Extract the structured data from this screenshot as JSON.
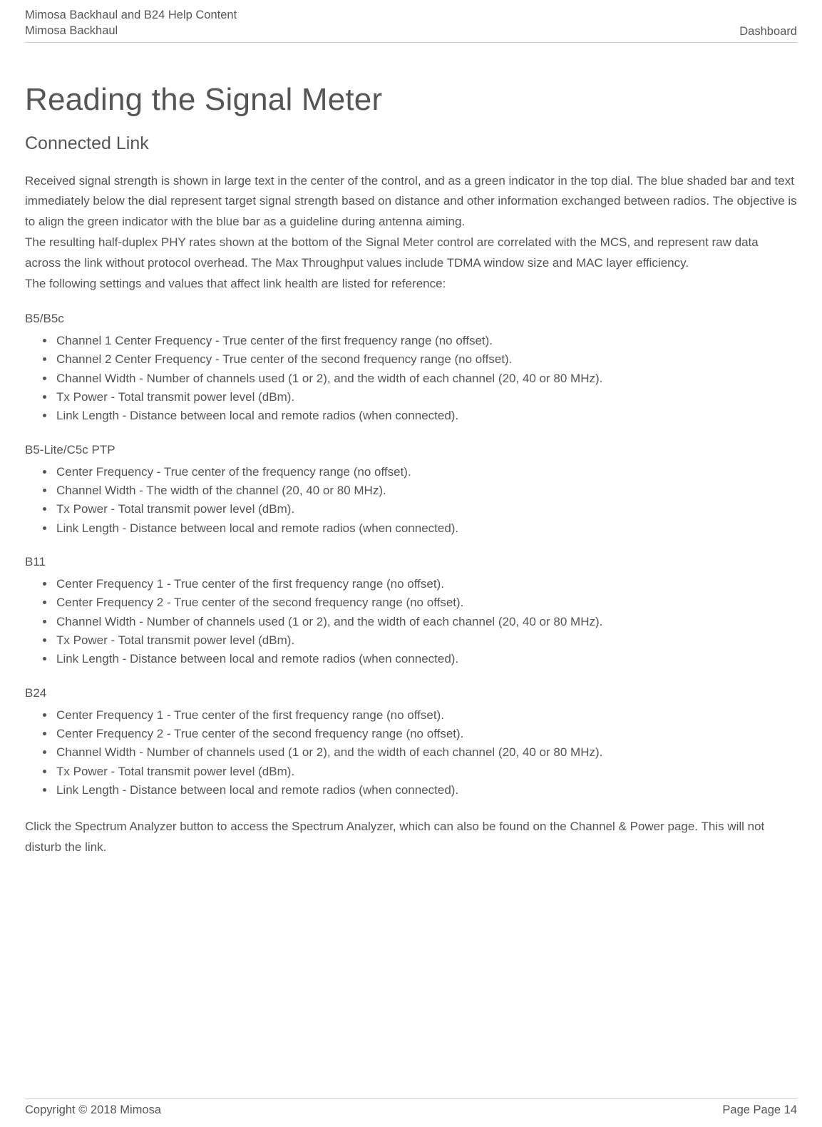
{
  "header": {
    "line1": "Mimosa Backhaul and B24 Help Content",
    "line2": "Mimosa Backhaul",
    "right": "Dashboard"
  },
  "title": "Reading the Signal Meter",
  "subtitle": "Connected Link",
  "paragraphs": {
    "p1": "Received signal strength is shown in large text in the center of the control, and as a green indicator in the top dial. The blue shaded bar and text immediately below the dial represent target signal strength based on distance and other information exchanged between radios. The objective is to align the green indicator with the blue bar as a guideline during antenna aiming.",
    "p2": "The resulting half-duplex PHY rates shown at the bottom of the Signal Meter control are correlated with the MCS, and represent raw data across the link without protocol overhead. The Max Throughput values include TDMA window size and MAC layer efficiency.",
    "p3": "The following settings and values that affect link health are listed for reference:"
  },
  "sections": [
    {
      "label": "B5/B5c",
      "items": [
        "Channel 1 Center Frequency - True center of the first frequency range (no offset).",
        "Channel 2 Center Frequency - True center of the second frequency range (no offset).",
        "Channel Width - Number of channels used (1 or 2), and the width of each channel (20, 40 or 80 MHz).",
        "Tx Power - Total transmit power level (dBm).",
        "Link Length - Distance between local and remote radios (when connected)."
      ]
    },
    {
      "label": "B5-Lite/C5c PTP",
      "items": [
        "Center Frequency - True center of the frequency range (no offset).",
        "Channel Width - The width of the channel (20, 40 or 80 MHz).",
        "Tx Power - Total transmit power level (dBm).",
        "Link Length - Distance between local and remote radios (when connected)."
      ]
    },
    {
      "label": "B11",
      "items": [
        "Center Frequency 1 - True center of the first frequency range (no offset).",
        "Center Frequency 2 - True center of the second frequency range (no offset).",
        "Channel Width - Number of channels used (1 or 2), and the width of each channel (20, 40 or 80 MHz).",
        "Tx Power - Total transmit power level (dBm).",
        "Link Length - Distance between local and remote radios (when connected)."
      ]
    },
    {
      "label": "B24",
      "items": [
        "Center Frequency 1 - True center of the first frequency range (no offset).",
        "Center Frequency 2 - True center of the second frequency range (no offset).",
        "Channel Width - Number of channels used (1 or 2), and the width of each channel (20, 40 or 80 MHz).",
        "Tx Power - Total transmit power level (dBm).",
        "Link Length - Distance between local and remote radios (when connected)."
      ]
    }
  ],
  "closing": "Click the Spectrum Analyzer button to access the Spectrum Analyzer, which can also be found on the Channel & Power page. This will not disturb the link.",
  "footer": {
    "left": "Copyright © 2018 Mimosa",
    "right": "Page Page 14"
  }
}
